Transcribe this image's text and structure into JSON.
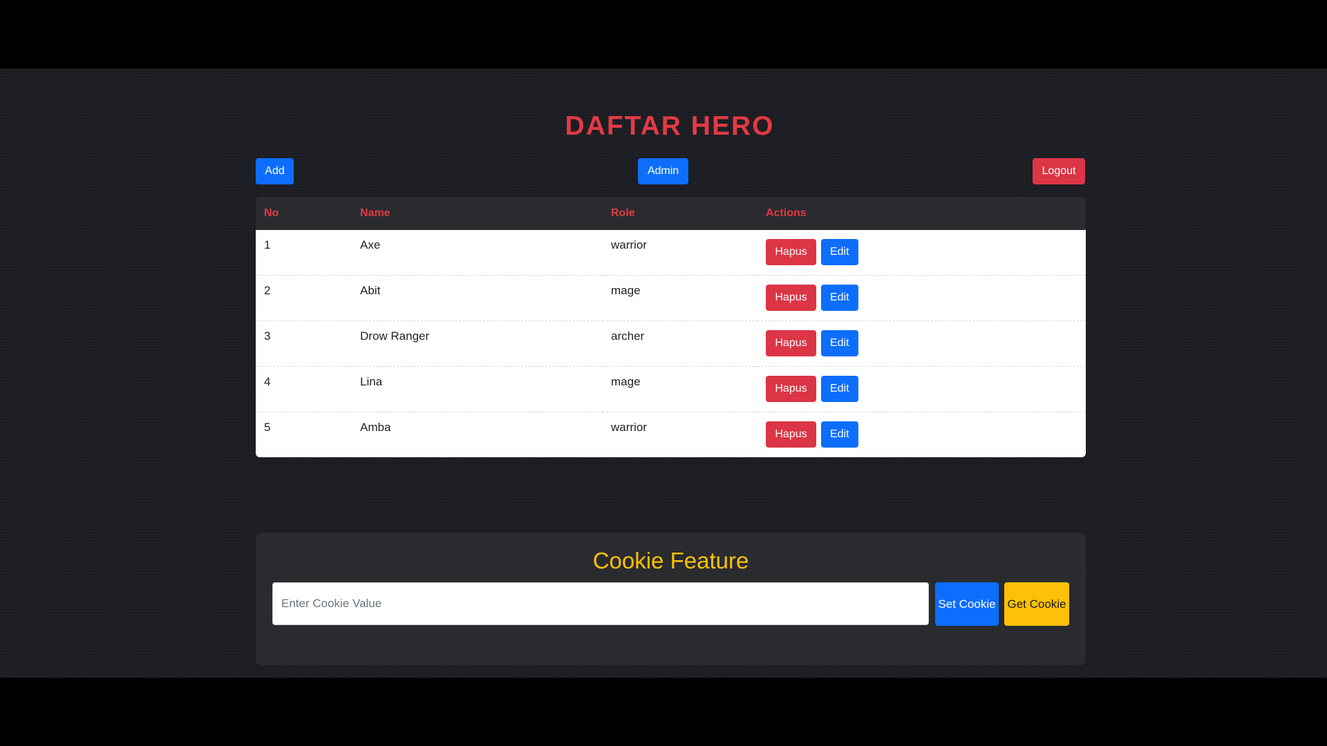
{
  "page": {
    "title": "DAFTAR HERO"
  },
  "toolbar": {
    "add_label": "Add",
    "admin_label": "Admin",
    "logout_label": "Logout"
  },
  "table": {
    "headers": [
      "No",
      "Name",
      "Role",
      "Actions"
    ],
    "rows": [
      {
        "no": "1",
        "name": "Axe",
        "role": "warrior",
        "delete_label": "Hapus",
        "edit_label": "Edit"
      },
      {
        "no": "2",
        "name": "Abit",
        "role": "mage",
        "delete_label": "Hapus",
        "edit_label": "Edit"
      },
      {
        "no": "3",
        "name": "Drow Ranger",
        "role": "archer",
        "delete_label": "Hapus",
        "edit_label": "Edit"
      },
      {
        "no": "4",
        "name": "Lina",
        "role": "mage",
        "delete_label": "Hapus",
        "edit_label": "Edit"
      },
      {
        "no": "5",
        "name": "Amba",
        "role": "warrior",
        "delete_label": "Hapus",
        "edit_label": "Edit"
      }
    ]
  },
  "cookie": {
    "title": "Cookie Feature",
    "input_value": "",
    "input_placeholder": "Enter Cookie Value",
    "set_label": "Set Cookie",
    "get_label": "Get Cookie"
  },
  "colors": {
    "title_red": "#e23a45",
    "primary_blue": "#0d6efd",
    "danger_red": "#dc3545",
    "warning_yellow": "#ffc107",
    "background": "#1b1d23",
    "panel": "#2a2b2f"
  }
}
